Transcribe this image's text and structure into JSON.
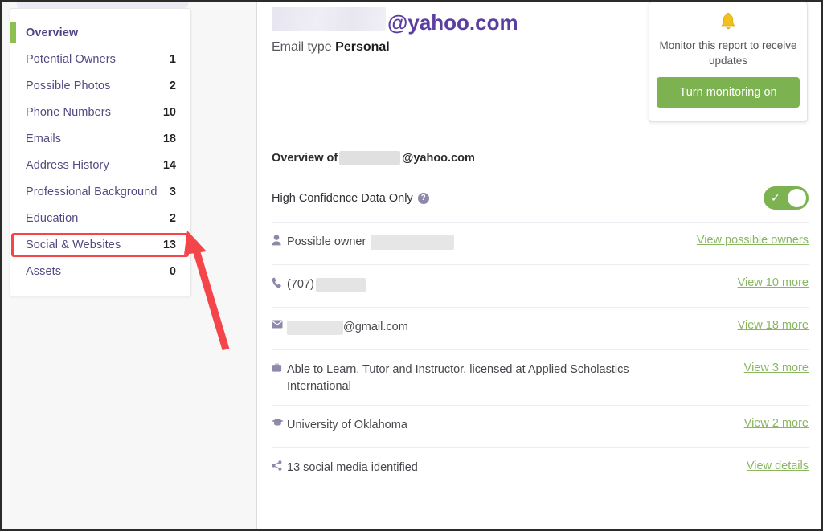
{
  "sidebar": {
    "items": [
      {
        "label": "Overview",
        "count": "",
        "active": true
      },
      {
        "label": "Potential Owners",
        "count": "1",
        "active": false
      },
      {
        "label": "Possible Photos",
        "count": "2",
        "active": false
      },
      {
        "label": "Phone Numbers",
        "count": "10",
        "active": false
      },
      {
        "label": "Emails",
        "count": "18",
        "active": false
      },
      {
        "label": "Address History",
        "count": "14",
        "active": false
      },
      {
        "label": "Professional Background",
        "count": "3",
        "active": false
      },
      {
        "label": "Education",
        "count": "2",
        "active": false
      },
      {
        "label": "Social & Websites",
        "count": "13",
        "active": false
      },
      {
        "label": "Assets",
        "count": "0",
        "active": false
      }
    ]
  },
  "annotation": {
    "highlight_target": "Social & Websites",
    "color": "#f4454b"
  },
  "header": {
    "email_domain": "@yahoo.com",
    "email_type_label": "Email type",
    "email_type_value": "Personal"
  },
  "monitor_card": {
    "icon": "bell-icon",
    "message": "Monitor this report to receive updates",
    "button_label": "Turn monitoring on",
    "button_color": "#7cb350"
  },
  "overview": {
    "title_prefix": "Overview of",
    "title_suffix": "@yahoo.com",
    "toggle": {
      "label": "High Confidence Data Only",
      "help_icon": "question-mark-icon",
      "state": "on",
      "check_glyph": "✓"
    },
    "rows": [
      {
        "icon": "person-icon",
        "text_prefix": "Possible owner",
        "text_suffix": "",
        "link": "View possible owners"
      },
      {
        "icon": "phone-icon",
        "text_prefix": "(707)",
        "text_suffix": "",
        "link": "View 10 more"
      },
      {
        "icon": "envelope-icon",
        "text_prefix": "",
        "text_suffix": "@gmail.com",
        "link": "View 18 more"
      },
      {
        "icon": "briefcase-icon",
        "text_prefix": "Able to Learn, Tutor and Instructor, licensed at Applied Scholastics International",
        "text_suffix": "",
        "link": "View 3 more"
      },
      {
        "icon": "graduation-cap-icon",
        "text_prefix": "University of Oklahoma",
        "text_suffix": "",
        "link": "View 2 more"
      },
      {
        "icon": "share-icon",
        "text_prefix": "13 social media identified",
        "text_suffix": "",
        "link": "View details"
      }
    ]
  },
  "colors": {
    "accent_green": "#8cc152",
    "link_green": "#8ab661",
    "nav_purple": "#514b82",
    "header_purple": "#5a3fa0"
  }
}
